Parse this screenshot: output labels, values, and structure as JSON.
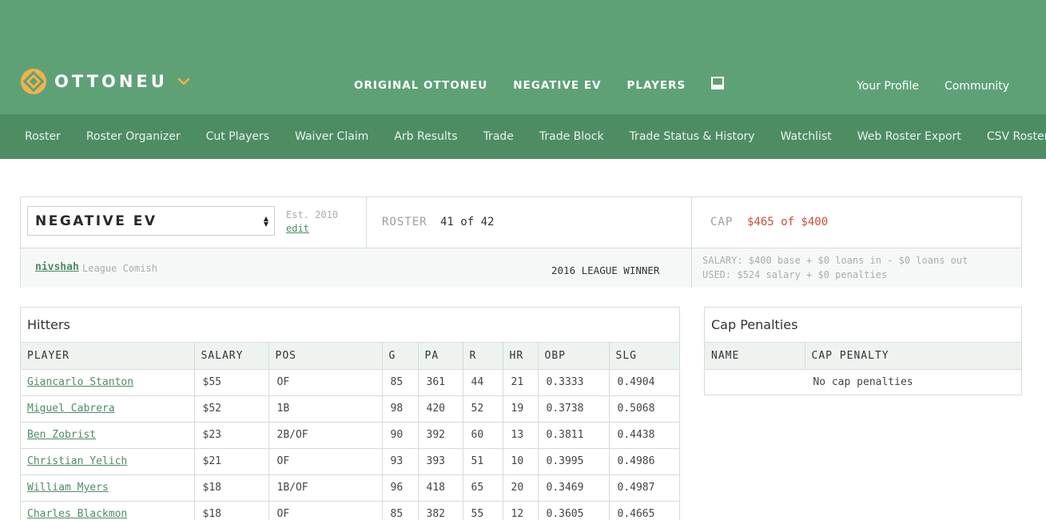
{
  "brand": {
    "name": "OTTONEU",
    "logo_color": "#f2b34a"
  },
  "main_nav": [
    {
      "label": "ORIGINAL OTTONEU"
    },
    {
      "label": "NEGATIVE EV"
    },
    {
      "label": "PLAYERS"
    }
  ],
  "main_nav_icon": "inbox-icon",
  "user_nav": {
    "profile": "Your Profile",
    "community": "Community"
  },
  "sub_nav": [
    "Roster",
    "Roster Organizer",
    "Cut Players",
    "Waiver Claim",
    "Arb Results",
    "Trade",
    "Trade Block",
    "Trade Status & History",
    "Watchlist",
    "Web Roster Export",
    "CSV Roster Export"
  ],
  "league": {
    "selected": "NEGATIVE EV",
    "established": "Est. 2010",
    "edit_label": "edit",
    "roster_label": "ROSTER",
    "roster_value": "41 of 42",
    "cap_label": "CAP",
    "cap_value": "$465 of $400",
    "comish_name": "nivshah",
    "comish_role": "League Comish",
    "winner": "2016 LEAGUE WINNER",
    "salary_line": "SALARY: $400 base + $0 loans in - $0 loans out",
    "used_line": "USED: $524 salary + $0 penalties"
  },
  "hitters": {
    "title": "Hitters",
    "columns": [
      "PLAYER",
      "SALARY",
      "POS",
      "G",
      "PA",
      "R",
      "HR",
      "OBP",
      "SLG"
    ],
    "rows": [
      [
        "Giancarlo Stanton",
        "$55",
        "OF",
        "85",
        "361",
        "44",
        "21",
        "0.3333",
        "0.4904"
      ],
      [
        "Miguel Cabrera",
        "$52",
        "1B",
        "98",
        "420",
        "52",
        "19",
        "0.3738",
        "0.5068"
      ],
      [
        "Ben Zobrist",
        "$23",
        "2B/OF",
        "90",
        "392",
        "60",
        "13",
        "0.3811",
        "0.4438"
      ],
      [
        "Christian Yelich",
        "$21",
        "OF",
        "93",
        "393",
        "51",
        "10",
        "0.3995",
        "0.4986"
      ],
      [
        "William Myers",
        "$18",
        "1B/OF",
        "96",
        "418",
        "65",
        "20",
        "0.3469",
        "0.4987"
      ],
      [
        "Charles Blackmon",
        "$18",
        "OF",
        "85",
        "382",
        "55",
        "12",
        "0.3605",
        "0.4665"
      ]
    ]
  },
  "cap_penalties": {
    "title": "Cap Penalties",
    "columns": [
      "NAME",
      "CAP PENALTY"
    ],
    "empty_text": "No cap penalties"
  },
  "colors": {
    "header_green": "#5fa177",
    "subnav_green": "#4e8c64",
    "link_green": "#4e8c64",
    "over_cap_red": "#cf4b3c"
  }
}
